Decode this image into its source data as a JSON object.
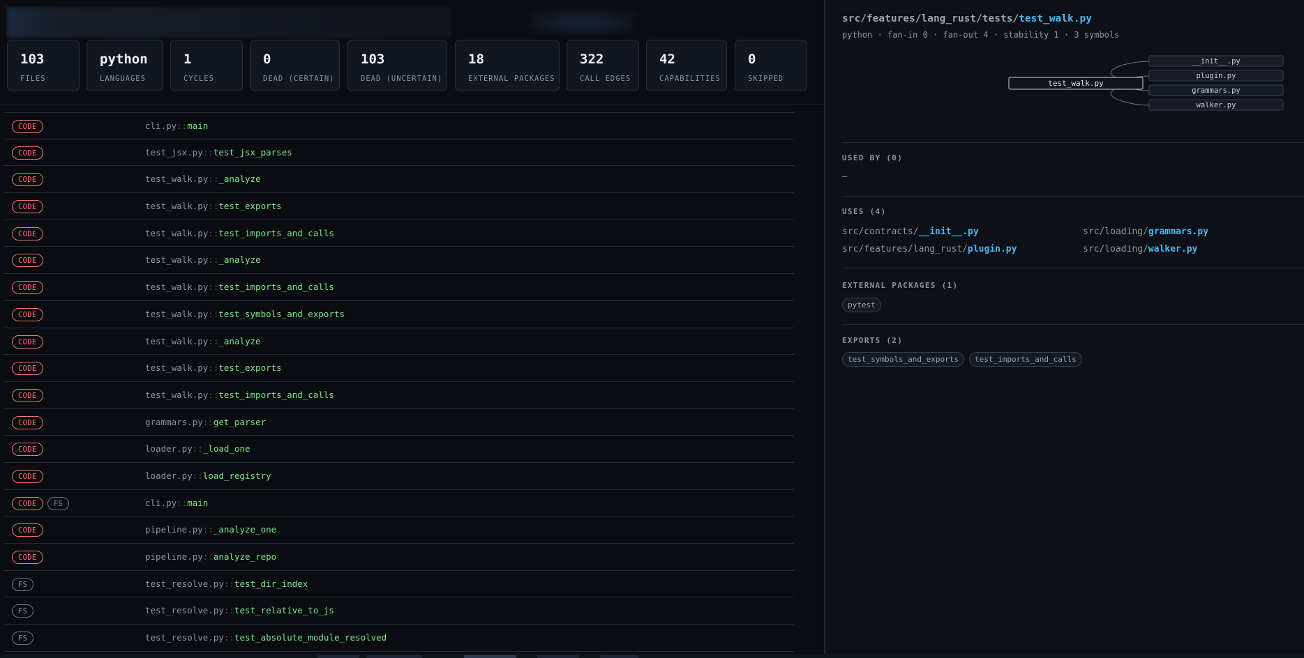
{
  "stats": [
    {
      "value": "103",
      "label": "FILES"
    },
    {
      "value": "python",
      "label": "LANGUAGES"
    },
    {
      "value": "1",
      "label": "CYCLES"
    },
    {
      "value": "0",
      "label": "DEAD (CERTAIN)"
    },
    {
      "value": "103",
      "label": "DEAD (UNCERTAIN)"
    },
    {
      "value": "18",
      "label": "EXTERNAL PACKAGES"
    },
    {
      "value": "322",
      "label": "CALL EDGES"
    },
    {
      "value": "42",
      "label": "CAPABILITIES"
    },
    {
      "value": "0",
      "label": "SKIPPED"
    }
  ],
  "rows": [
    {
      "badges": [
        "CODE"
      ],
      "file": "cli.py",
      "sep": "::",
      "fn": "main"
    },
    {
      "badges": [
        "CODE"
      ],
      "file": "test_jsx.py",
      "sep": "::",
      "fn": "test_jsx_parses"
    },
    {
      "badges": [
        "CODE"
      ],
      "file": "test_walk.py",
      "sep": "::",
      "fn": "_analyze"
    },
    {
      "badges": [
        "CODE"
      ],
      "file": "test_walk.py",
      "sep": "::",
      "fn": "test_exports"
    },
    {
      "badges": [
        "CODE"
      ],
      "file": "test_walk.py",
      "sep": "::",
      "fn": "test_imports_and_calls"
    },
    {
      "badges": [
        "CODE"
      ],
      "file": "test_walk.py",
      "sep": "::",
      "fn": "_analyze"
    },
    {
      "badges": [
        "CODE"
      ],
      "file": "test_walk.py",
      "sep": "::",
      "fn": "test_imports_and_calls"
    },
    {
      "badges": [
        "CODE"
      ],
      "file": "test_walk.py",
      "sep": "::",
      "fn": "test_symbols_and_exports"
    },
    {
      "badges": [
        "CODE"
      ],
      "file": "test_walk.py",
      "sep": "::",
      "fn": "_analyze"
    },
    {
      "badges": [
        "CODE"
      ],
      "file": "test_walk.py",
      "sep": "::",
      "fn": "test_exports"
    },
    {
      "badges": [
        "CODE"
      ],
      "file": "test_walk.py",
      "sep": "::",
      "fn": "test_imports_and_calls"
    },
    {
      "badges": [
        "CODE"
      ],
      "file": "grammars.py",
      "sep": "::",
      "fn": "get_parser"
    },
    {
      "badges": [
        "CODE"
      ],
      "file": "loader.py",
      "sep": "::",
      "fn": "_load_one"
    },
    {
      "badges": [
        "CODE"
      ],
      "file": "loader.py",
      "sep": "::",
      "fn": "load_registry"
    },
    {
      "badges": [
        "CODE",
        "FS"
      ],
      "file": "cli.py",
      "sep": "::",
      "fn": "main"
    },
    {
      "badges": [
        "CODE"
      ],
      "file": "pipeline.py",
      "sep": "::",
      "fn": "_analyze_one"
    },
    {
      "badges": [
        "CODE"
      ],
      "file": "pipeline.py",
      "sep": "::",
      "fn": "analyze_repo"
    },
    {
      "badges": [
        "FS"
      ],
      "file": "test_resolve.py",
      "sep": "::",
      "fn": "test_dir_index"
    },
    {
      "badges": [
        "FS"
      ],
      "file": "test_resolve.py",
      "sep": "::",
      "fn": "test_relative_to_js"
    },
    {
      "badges": [
        "FS"
      ],
      "file": "test_resolve.py",
      "sep": "::",
      "fn": "test_absolute_module_resolved"
    }
  ],
  "detail": {
    "path_prefix": "src/features/lang_rust/tests/",
    "path_file": "test_walk.py",
    "meta": "python · fan-in 0 · fan-out 4 · stability 1 · 3 symbols",
    "graph": {
      "center": "test_walk.py",
      "targets": [
        "__init__.py",
        "plugin.py",
        "grammars.py",
        "walker.py"
      ]
    },
    "used_by_title": "USED BY (0)",
    "used_by_empty": "—",
    "uses_title": "USES (4)",
    "uses": [
      {
        "prefix": "src/contracts/",
        "file": "__init__.py"
      },
      {
        "prefix": "src/loading/",
        "file": "grammars.py"
      },
      {
        "prefix": "src/features/lang_rust/",
        "file": "plugin.py"
      },
      {
        "prefix": "src/loading/",
        "file": "walker.py"
      }
    ],
    "external_title": "EXTERNAL PACKAGES (1)",
    "external": [
      "pytest"
    ],
    "exports_title": "EXPORTS (2)",
    "exports": [
      "test_symbols_and_exports",
      "test_imports_and_calls"
    ]
  },
  "colors": {
    "accent": "#4fb6f0",
    "code_badge": "#f07b6a",
    "function": "#7ee787"
  }
}
